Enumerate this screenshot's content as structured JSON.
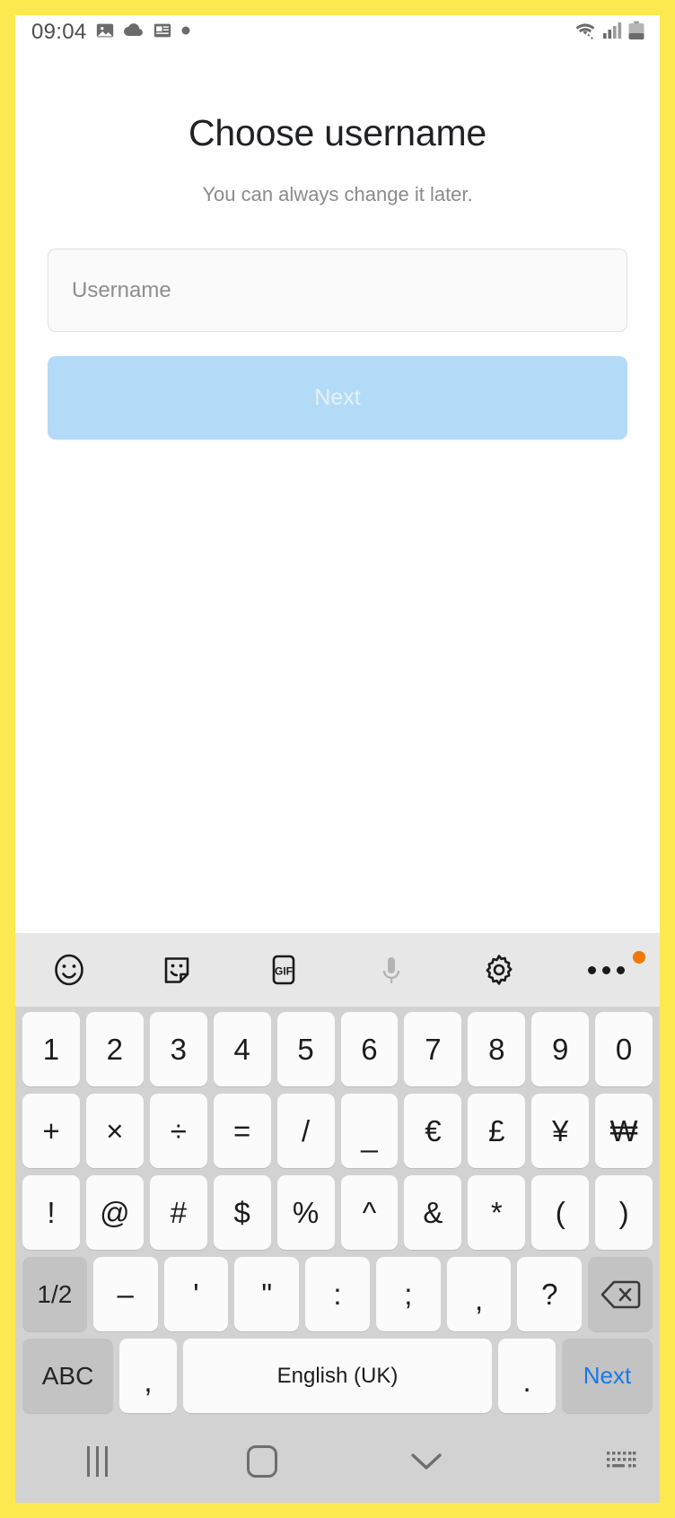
{
  "theme": {
    "border_color": "#fbe94f",
    "accent_blue": "#1b77e8",
    "next_button_bg": "#b3dbf7",
    "keyboard_bg": "#d2d2d2",
    "key_bg": "#fbfbfb",
    "fn_key_bg": "#c3c3c3",
    "badge_color": "#f07800"
  },
  "status_bar": {
    "time": "09:04",
    "left_icons": [
      "image-icon",
      "cloud-icon",
      "news-icon",
      "dot-icon"
    ],
    "right_icons": [
      "wifi-icon",
      "signal-icon",
      "battery-icon"
    ]
  },
  "screen": {
    "title": "Choose username",
    "subtitle": "You can always change it later.",
    "username_field": {
      "value": "",
      "placeholder": "Username"
    },
    "next_button": {
      "label": "Next",
      "enabled": false
    }
  },
  "keyboard": {
    "toolbar": [
      {
        "name": "emoji-icon",
        "label": ""
      },
      {
        "name": "sticker-icon",
        "label": ""
      },
      {
        "name": "gif-icon",
        "label": "GIF"
      },
      {
        "name": "microphone-icon",
        "label": ""
      },
      {
        "name": "settings-gear-icon",
        "label": ""
      },
      {
        "name": "overflow-menu-icon",
        "label": "",
        "badge": true
      }
    ],
    "row1": [
      "1",
      "2",
      "3",
      "4",
      "5",
      "6",
      "7",
      "8",
      "9",
      "0"
    ],
    "row2": [
      "+",
      "×",
      "÷",
      "=",
      "/",
      "_",
      "€",
      "£",
      "¥",
      "₩"
    ],
    "row3": [
      "!",
      "@",
      "#",
      "$",
      "%",
      "^",
      "&",
      "*",
      "(",
      ")"
    ],
    "row4": {
      "page_toggle": "1/2",
      "keys": [
        "–",
        "'",
        "\"",
        ":",
        ";",
        ",",
        "?"
      ],
      "backspace": "backspace-icon"
    },
    "row5": {
      "abc": "ABC",
      "comma": ",",
      "space": "English (UK)",
      "period": ".",
      "action": "Next"
    }
  },
  "nav_bar": {
    "recents": "recents-icon",
    "home": "home-icon",
    "hide_keyboard": "chevron-down-icon",
    "keyboard_switch": "keyboard-switch-icon"
  }
}
